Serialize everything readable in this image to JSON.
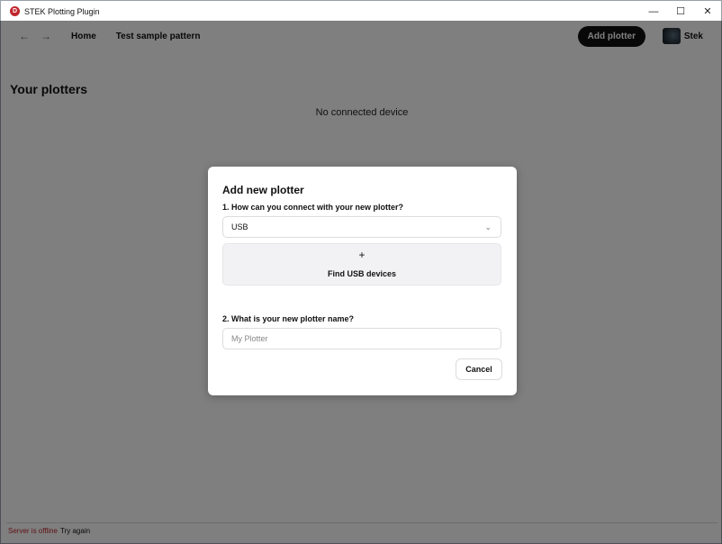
{
  "window": {
    "title": "STEK Plotting Plugin",
    "logo_letter": "D",
    "controls": {
      "minimize": "—",
      "maximize": "☐",
      "close": "✕"
    }
  },
  "nav": {
    "back": "←",
    "forward": "→",
    "links": [
      "Home",
      "Test sample pattern"
    ],
    "add_plotter_label": "Add plotter",
    "user_name": "Stek"
  },
  "main": {
    "section_title": "Your plotters",
    "empty_message": "No connected device"
  },
  "status": {
    "offline_text": "Server is offline",
    "retry_text": "Try again"
  },
  "modal": {
    "title": "Add new plotter",
    "question1": "1. How can you connect with your new plotter?",
    "connection_selected": "USB",
    "find_plus": "+",
    "find_label": "Find USB devices",
    "question2": "2. What is your new plotter name?",
    "name_placeholder": "My Plotter",
    "cancel_label": "Cancel"
  },
  "colors": {
    "accent_dark": "#111111",
    "offline_red": "#c0262d",
    "logo_red": "#c0262d"
  }
}
